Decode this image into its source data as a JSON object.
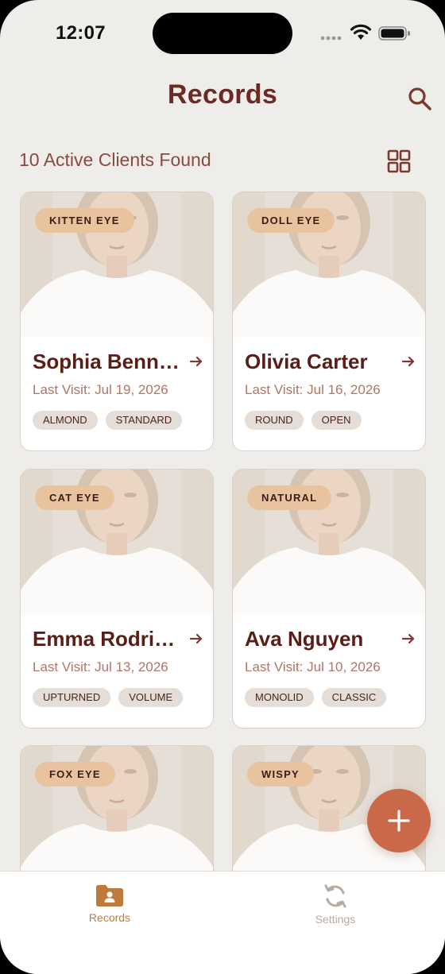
{
  "status_bar": {
    "time": "12:07"
  },
  "header": {
    "title": "Records"
  },
  "summary": {
    "count_text": "10 Active Clients Found"
  },
  "records": [
    {
      "style": "KITTEN EYE",
      "name": "Sophia Benne...",
      "last_visit": "Last Visit: Jul 19, 2026",
      "tags": [
        "ALMOND",
        "STANDARD"
      ]
    },
    {
      "style": "DOLL EYE",
      "name": "Olivia Carter",
      "last_visit": "Last Visit: Jul 16, 2026",
      "tags": [
        "ROUND",
        "OPEN"
      ]
    },
    {
      "style": "CAT EYE",
      "name": "Emma Rodrig...",
      "last_visit": "Last Visit: Jul 13, 2026",
      "tags": [
        "UPTURNED",
        "VOLUME"
      ]
    },
    {
      "style": "NATURAL",
      "name": "Ava Nguyen",
      "last_visit": "Last Visit: Jul 10, 2026",
      "tags": [
        "MONOLID",
        "CLASSIC"
      ]
    },
    {
      "style": "FOX EYE",
      "name": "",
      "last_visit": "",
      "tags": []
    },
    {
      "style": "WISPY",
      "name": "",
      "last_visit": "",
      "tags": []
    }
  ],
  "fab": {
    "icon": "plus-icon"
  },
  "tabbar": {
    "tabs": [
      {
        "label": "Records",
        "icon": "folder-person-icon",
        "active": true
      },
      {
        "label": "Settings",
        "icon": "sync-icon",
        "active": false
      }
    ]
  },
  "colors": {
    "accent": "#6B2A23",
    "badge": "#E9C39E",
    "fab": "#C9694A",
    "active_tab": "#C07A3C",
    "inactive_tab": "#B8A9A1",
    "background": "#EFEDEA"
  }
}
